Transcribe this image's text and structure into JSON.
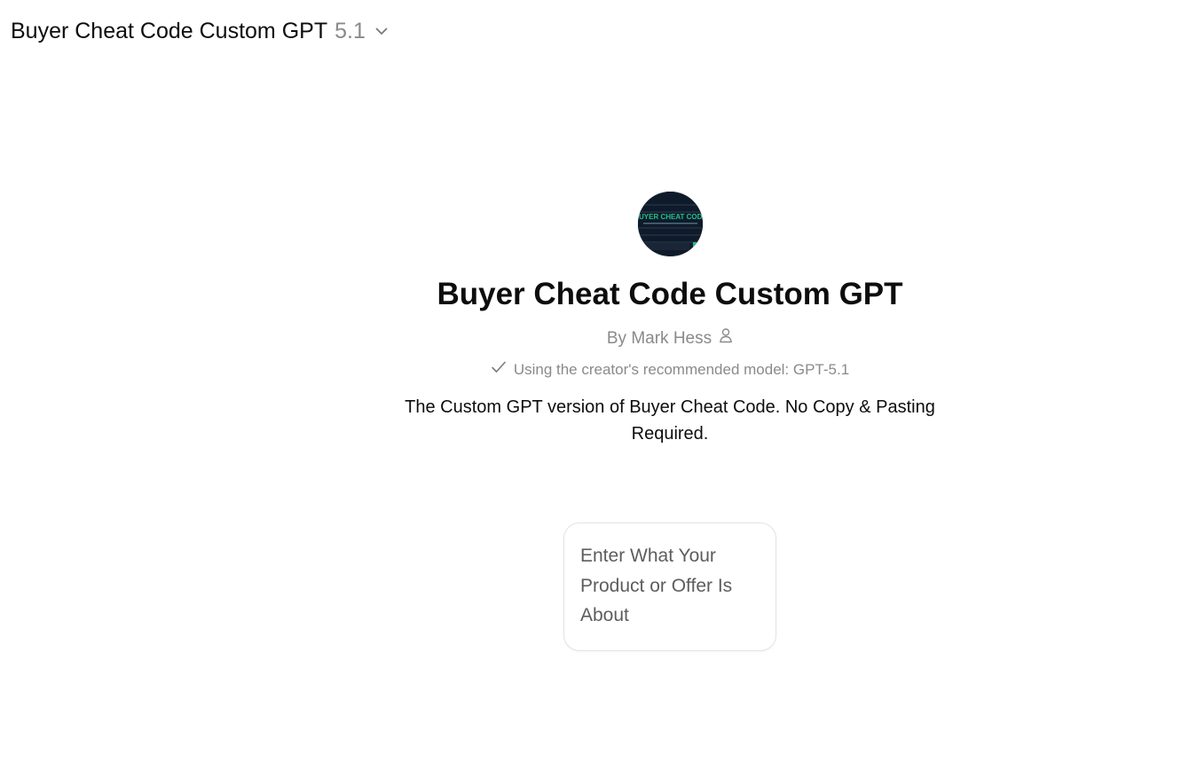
{
  "header": {
    "title": "Buyer Cheat Code Custom GPT",
    "version": "5.1",
    "chevron_icon": "chevron-down-icon"
  },
  "gpt": {
    "avatar_text": "BUYER CHEAT CODE",
    "title": "Buyer Cheat Code Custom GPT",
    "byline": "By Mark Hess",
    "byline_icon": "person-icon",
    "model_note": "Using the creator's recommended model: GPT-5.1",
    "model_note_icon": "checkmark-icon",
    "description": "The Custom GPT version of Buyer Cheat Code. No Copy & Pasting Required."
  },
  "starters": [
    {
      "text": "Enter What Your Product or Offer Is About"
    }
  ],
  "colors": {
    "text_primary": "#0d0d0d",
    "text_secondary": "#8a8a8a",
    "starter_text": "#5d5d5d",
    "card_border": "#e3e3e3",
    "avatar_bg": "#0f1b2a",
    "avatar_accent": "#22c08a"
  }
}
